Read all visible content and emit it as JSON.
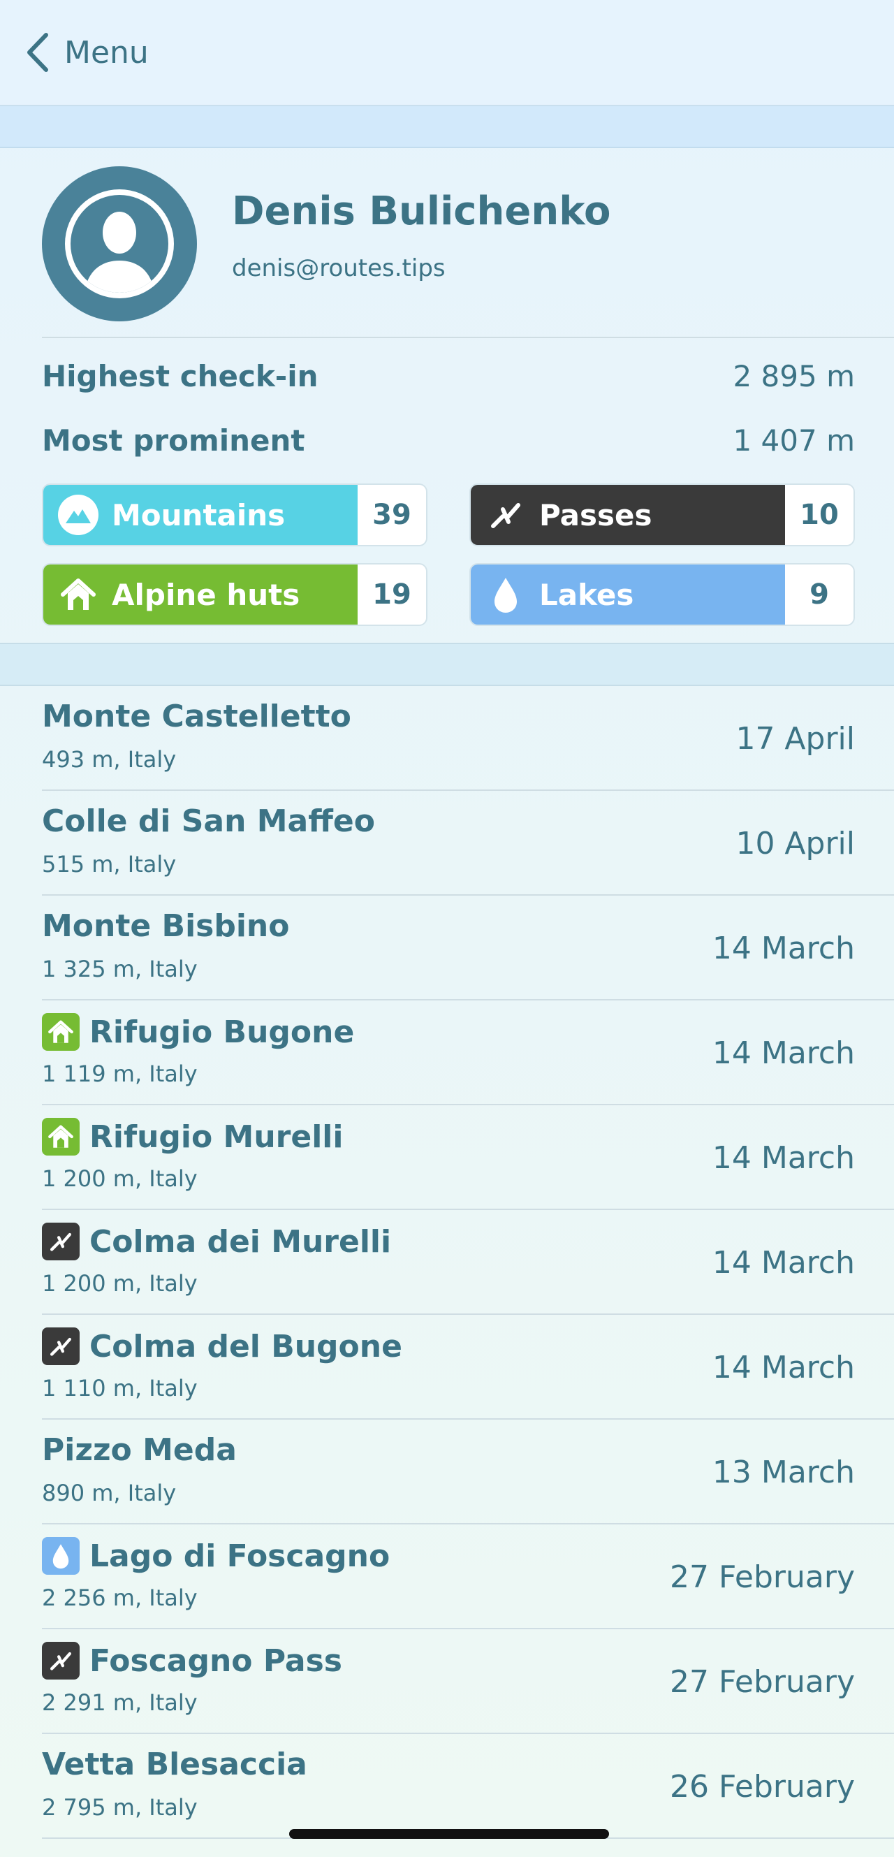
{
  "nav": {
    "back_label": "Menu"
  },
  "profile": {
    "name": "Denis Bulichenko",
    "email": "denis@routes.tips"
  },
  "stats": {
    "highest_label": "Highest check-in",
    "highest_value": "2 895 m",
    "prominent_label": "Most prominent",
    "prominent_value": "1 407 m"
  },
  "categories": [
    {
      "label": "Mountains",
      "count": "39",
      "color": "#57d2e4",
      "icon": "mountain-icon"
    },
    {
      "label": "Passes",
      "count": "10",
      "color": "#3a3a3a",
      "icon": "pass-icon"
    },
    {
      "label": "Alpine huts",
      "count": "19",
      "color": "#76bc33",
      "icon": "hut-icon"
    },
    {
      "label": "Lakes",
      "count": "9",
      "color": "#78b4f0",
      "icon": "drop-icon"
    }
  ],
  "checkins": [
    {
      "name": "Monte Castelletto",
      "sub": "493 m, Italy",
      "date": "17 April",
      "icon": ""
    },
    {
      "name": "Colle di San Maffeo",
      "sub": "515 m, Italy",
      "date": "10 April",
      "icon": ""
    },
    {
      "name": "Monte Bisbino",
      "sub": "1 325 m, Italy",
      "date": "14 March",
      "icon": ""
    },
    {
      "name": "Rifugio Bugone",
      "sub": "1 119 m, Italy",
      "date": "14 March",
      "icon": "hut"
    },
    {
      "name": "Rifugio Murelli",
      "sub": "1 200 m, Italy",
      "date": "14 March",
      "icon": "hut"
    },
    {
      "name": "Colma dei Murelli",
      "sub": "1 200 m, Italy",
      "date": "14 March",
      "icon": "pass"
    },
    {
      "name": "Colma del Bugone",
      "sub": "1 110 m, Italy",
      "date": "14 March",
      "icon": "pass"
    },
    {
      "name": "Pizzo Meda",
      "sub": "890 m, Italy",
      "date": "13 March",
      "icon": ""
    },
    {
      "name": "Lago di Foscagno",
      "sub": "2 256 m, Italy",
      "date": "27 February",
      "icon": "lake"
    },
    {
      "name": "Foscagno Pass",
      "sub": "2 291 m, Italy",
      "date": "27 February",
      "icon": "pass"
    },
    {
      "name": "Vetta Blesaccia",
      "sub": "2 795 m, Italy",
      "date": "26 February",
      "icon": ""
    }
  ]
}
